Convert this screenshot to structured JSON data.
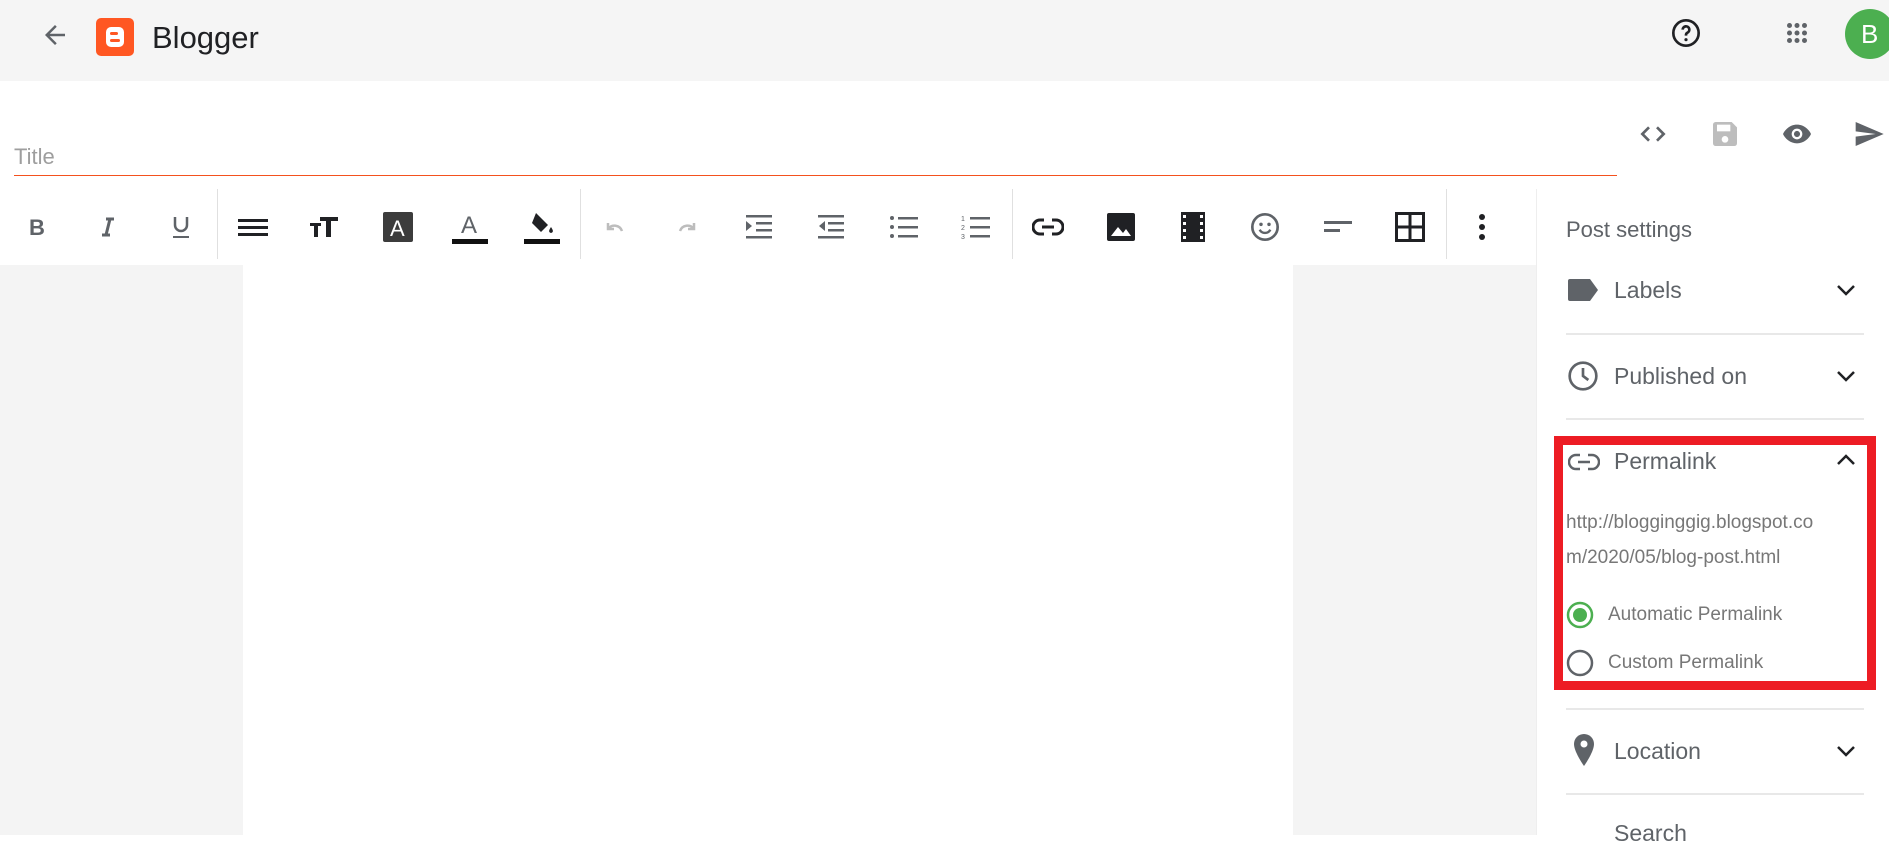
{
  "header": {
    "brand": "Blogger",
    "avatar_letter": "B",
    "icons": [
      "back-arrow-icon",
      "blogger-logo",
      "help-icon",
      "apps-grid-icon",
      "avatar"
    ]
  },
  "editor": {
    "title_placeholder": "Title",
    "title_value": "",
    "actions": [
      "html-view-icon",
      "save-icon",
      "preview-icon",
      "publish-icon"
    ]
  },
  "toolbar": {
    "items": [
      "bold",
      "italic",
      "underline",
      "align",
      "font-size",
      "text-style",
      "text-color",
      "highlight",
      "undo",
      "redo",
      "indent",
      "outdent",
      "bulleted-list",
      "numbered-list",
      "link",
      "image",
      "video",
      "emoji",
      "paragraph",
      "table",
      "more"
    ]
  },
  "sidebar": {
    "title": "Post settings",
    "labels": "Labels",
    "published_on": "Published on",
    "permalink": {
      "label": "Permalink",
      "url_line1": "http://blogginggig.blogspot.co",
      "url_line2": "m/2020/05/blog-post.html",
      "automatic": "Automatic Permalink",
      "custom": "Custom Permalink",
      "selected": "automatic"
    },
    "location": "Location",
    "search": "Search"
  },
  "colors": {
    "accent": "#f4511e",
    "radio": "#4caf50",
    "highlight_box": "#ed1c24",
    "avatar": "#4caf50"
  }
}
